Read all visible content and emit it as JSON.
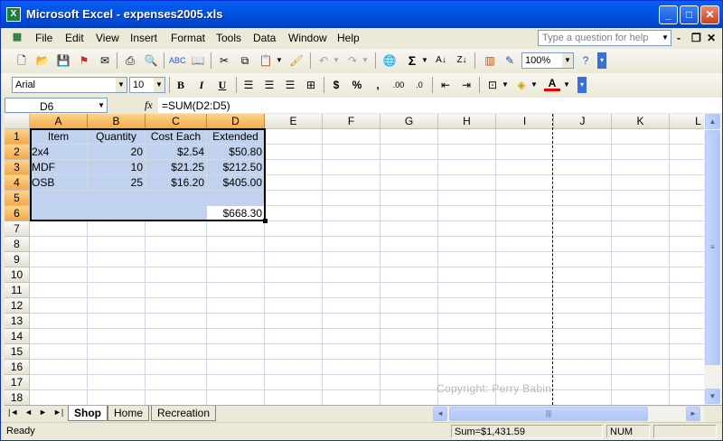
{
  "window": {
    "title": "Microsoft Excel - expenses2005.xls",
    "app_icon_text": "X",
    "controls": {
      "minimize": "_",
      "maximize": "□",
      "close": "✕"
    }
  },
  "menubar": {
    "items": [
      {
        "label": "File"
      },
      {
        "label": "Edit"
      },
      {
        "label": "View"
      },
      {
        "label": "Insert"
      },
      {
        "label": "Format"
      },
      {
        "label": "Tools"
      },
      {
        "label": "Data"
      },
      {
        "label": "Window"
      },
      {
        "label": "Help"
      }
    ],
    "question_placeholder": "Type a question for help",
    "doc_controls": {
      "minimize": "-",
      "restore": "❐",
      "close": "✕"
    }
  },
  "toolbar": {
    "standard_icons": [
      "new-icon",
      "open-icon",
      "save-icon",
      "permission-icon",
      "email-icon",
      "print-icon",
      "print-preview-icon",
      "spelling-icon",
      "research-icon",
      "cut-icon",
      "copy-icon",
      "paste-icon",
      "format-painter-icon",
      "undo-icon",
      "redo-icon",
      "hyperlink-icon",
      "autosum-icon",
      "sort-ascending-icon",
      "sort-descending-icon",
      "chart-wizard-icon",
      "drawing-icon",
      "help-icon"
    ],
    "zoom": "100%",
    "font_name": "Arial",
    "font_size": "10",
    "format_buttons": {
      "bold": "B",
      "italic": "I",
      "underline": "U",
      "currency": "$",
      "percent": "%",
      "comma": ",",
      "increase_decimal": ".00",
      "decrease_decimal": ".0"
    }
  },
  "formula_bar": {
    "name_box": "D6",
    "fx": "fx",
    "formula": "=SUM(D2:D5)"
  },
  "sheet": {
    "columns": [
      "A",
      "B",
      "C",
      "D",
      "E",
      "F",
      "G",
      "H",
      "I",
      "J",
      "K",
      "L"
    ],
    "rows": [
      "1",
      "2",
      "3",
      "4",
      "5",
      "6",
      "7",
      "8",
      "9",
      "10",
      "11",
      "12",
      "13",
      "14",
      "15",
      "16",
      "17",
      "18"
    ],
    "cells": {
      "A1": "Item",
      "B1": "Quantity",
      "C1": "Cost Each",
      "D1": "Extended",
      "A2": "2x4",
      "B2": "20",
      "C2": "$2.54",
      "D2": "$50.80",
      "A3": "MDF",
      "B3": "10",
      "C3": "$21.25",
      "D3": "$212.50",
      "A4": "OSB",
      "B4": "25",
      "C4": "$16.20",
      "D4": "$405.00",
      "D6": "$668.30"
    },
    "active_cell": "D6",
    "selection": "A1:D6",
    "watermark": "Copyright: Perry Babin"
  },
  "tabs": {
    "nav": [
      "|◄",
      "◄",
      "►",
      "►|"
    ],
    "sheets": [
      {
        "label": "Shop",
        "active": true
      },
      {
        "label": "Home",
        "active": false
      },
      {
        "label": "Recreation",
        "active": false
      }
    ]
  },
  "status": {
    "ready": "Ready",
    "sum": "Sum=$1,431.59",
    "num": "NUM"
  },
  "colors": {
    "title_blue": "#0054e3",
    "selection_fill": "#c1d2ee",
    "header_selected": "#f5a94b"
  }
}
